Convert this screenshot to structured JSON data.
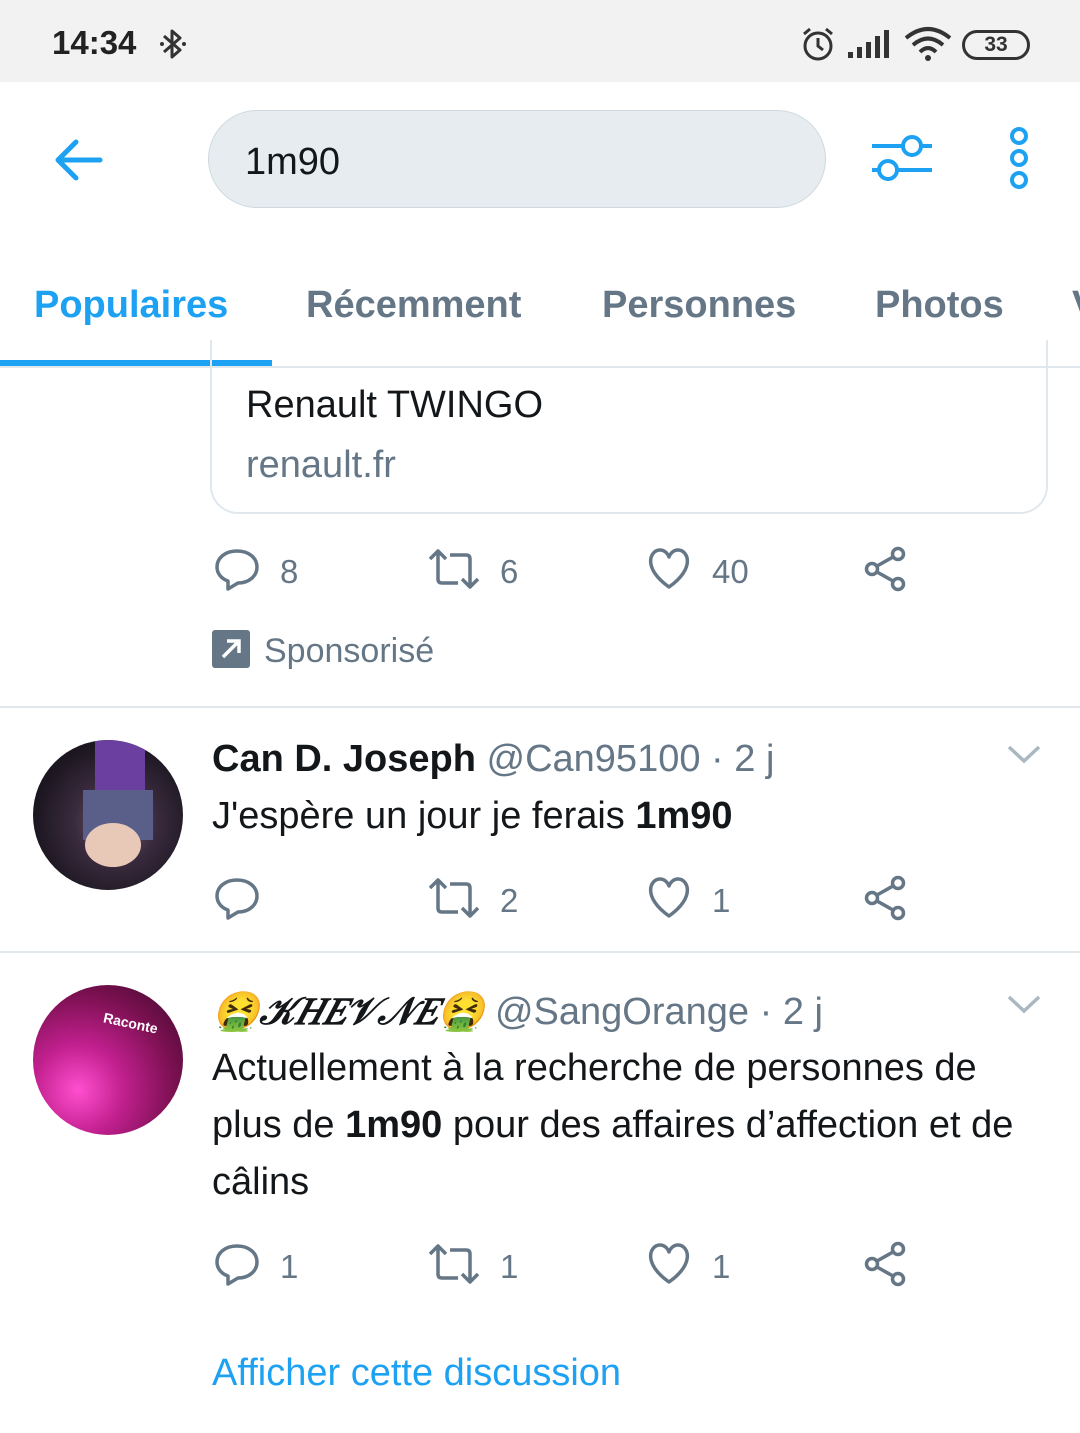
{
  "status_bar": {
    "time": "14:34",
    "battery": "33",
    "icons": [
      "bluetooth-icon",
      "alarm-icon",
      "signal-icon",
      "wifi-icon",
      "battery-icon"
    ]
  },
  "search": {
    "query": "1m90"
  },
  "tabs": [
    {
      "label": "Populaires",
      "active": true
    },
    {
      "label": "Récemment",
      "active": false
    },
    {
      "label": "Personnes",
      "active": false
    },
    {
      "label": "Photos",
      "active": false
    },
    {
      "label": "V",
      "active": false
    }
  ],
  "promoted": {
    "card_title": "Renault TWINGO",
    "card_domain": "renault.fr",
    "replies": "8",
    "retweets": "6",
    "likes": "40",
    "sponsored_label": "Sponsorisé"
  },
  "tweets": [
    {
      "name": "Can D. Joseph",
      "handle": "@Can95100",
      "time": "· 2 j",
      "text_before": "J'espère un jour je ferais ",
      "text_bold": "1m90",
      "text_after": "",
      "replies": "",
      "retweets": "2",
      "likes": "1"
    },
    {
      "name": "🤮𝒦𝐻𝐸𝒱𝒩𝐸🤮",
      "handle": "@SangOrange",
      "time": "· 2 j",
      "text_before": "Actuellement à la recherche de personnes de plus de ",
      "text_bold": "1m90",
      "text_after": " pour des affaires d’affection et de câlins",
      "avatar_text": "Raconte",
      "replies": "1",
      "retweets": "1",
      "likes": "1"
    }
  ],
  "show_thread": "Afficher cette discussion",
  "colors": {
    "accent": "#1da1f2",
    "secondary_text": "#657786",
    "border": "#e1e8ed"
  }
}
